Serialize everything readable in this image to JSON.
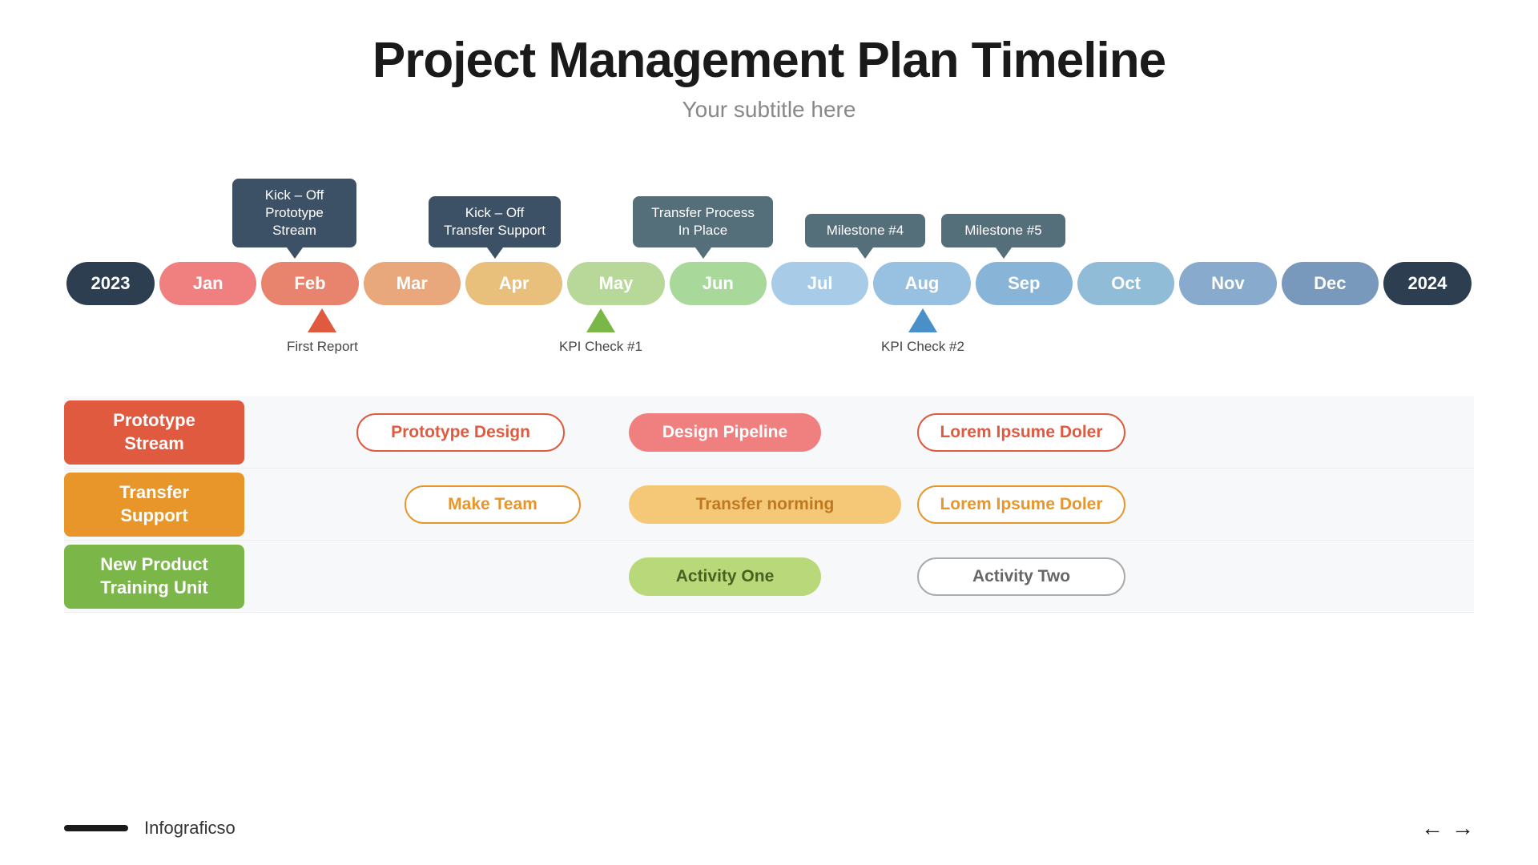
{
  "page": {
    "title": "Project Management Plan Timeline",
    "subtitle": "Your subtitle here"
  },
  "bubbles": [
    {
      "id": "kickoff1",
      "text": "Kick – Off\nPrototype Stream"
    },
    {
      "id": "kickoff2",
      "text": "Kick – Off\nTransfer Support"
    },
    {
      "id": "transfer",
      "text": "Transfer Process\nIn Place"
    },
    {
      "id": "milestone4",
      "text": "Milestone #4"
    },
    {
      "id": "milestone5",
      "text": "Milestone #5"
    }
  ],
  "months": [
    "2023",
    "Jan",
    "Feb",
    "Mar",
    "Apr",
    "May",
    "Jun",
    "Jul",
    "Aug",
    "Sep",
    "Oct",
    "Nov",
    "Dec",
    "2024"
  ],
  "markers": [
    {
      "id": "first-report",
      "label": "First Report",
      "color": "#e05a40"
    },
    {
      "id": "kpi-check1",
      "label": "KPI Check #1",
      "color": "#7ab648"
    },
    {
      "id": "kpi-check2",
      "label": "KPI Check #2",
      "color": "#4a90c8"
    }
  ],
  "streams": [
    {
      "id": "prototype-stream",
      "label": "Prototype\nStream",
      "items": [
        {
          "id": "prototype-design",
          "text": "Prototype Design"
        },
        {
          "id": "design-pipeline",
          "text": "Design Pipeline"
        },
        {
          "id": "lorem1",
          "text": "Lorem Ipsume Doler"
        }
      ]
    },
    {
      "id": "transfer-stream",
      "label": "Transfer\nSupport",
      "items": [
        {
          "id": "make-team",
          "text": "Make Team"
        },
        {
          "id": "transfer-norming",
          "text": "Transfer norming"
        },
        {
          "id": "lorem2",
          "text": "Lorem Ipsume Doler"
        }
      ]
    },
    {
      "id": "newproduct-stream",
      "label": "New Product\nTraining Unit",
      "items": [
        {
          "id": "activity-one",
          "text": "Activity One"
        },
        {
          "id": "activity-two",
          "text": "Activity Two"
        }
      ]
    }
  ],
  "footer": {
    "brand": "Infograficso",
    "arrow_left": "←",
    "arrow_right": "→"
  }
}
